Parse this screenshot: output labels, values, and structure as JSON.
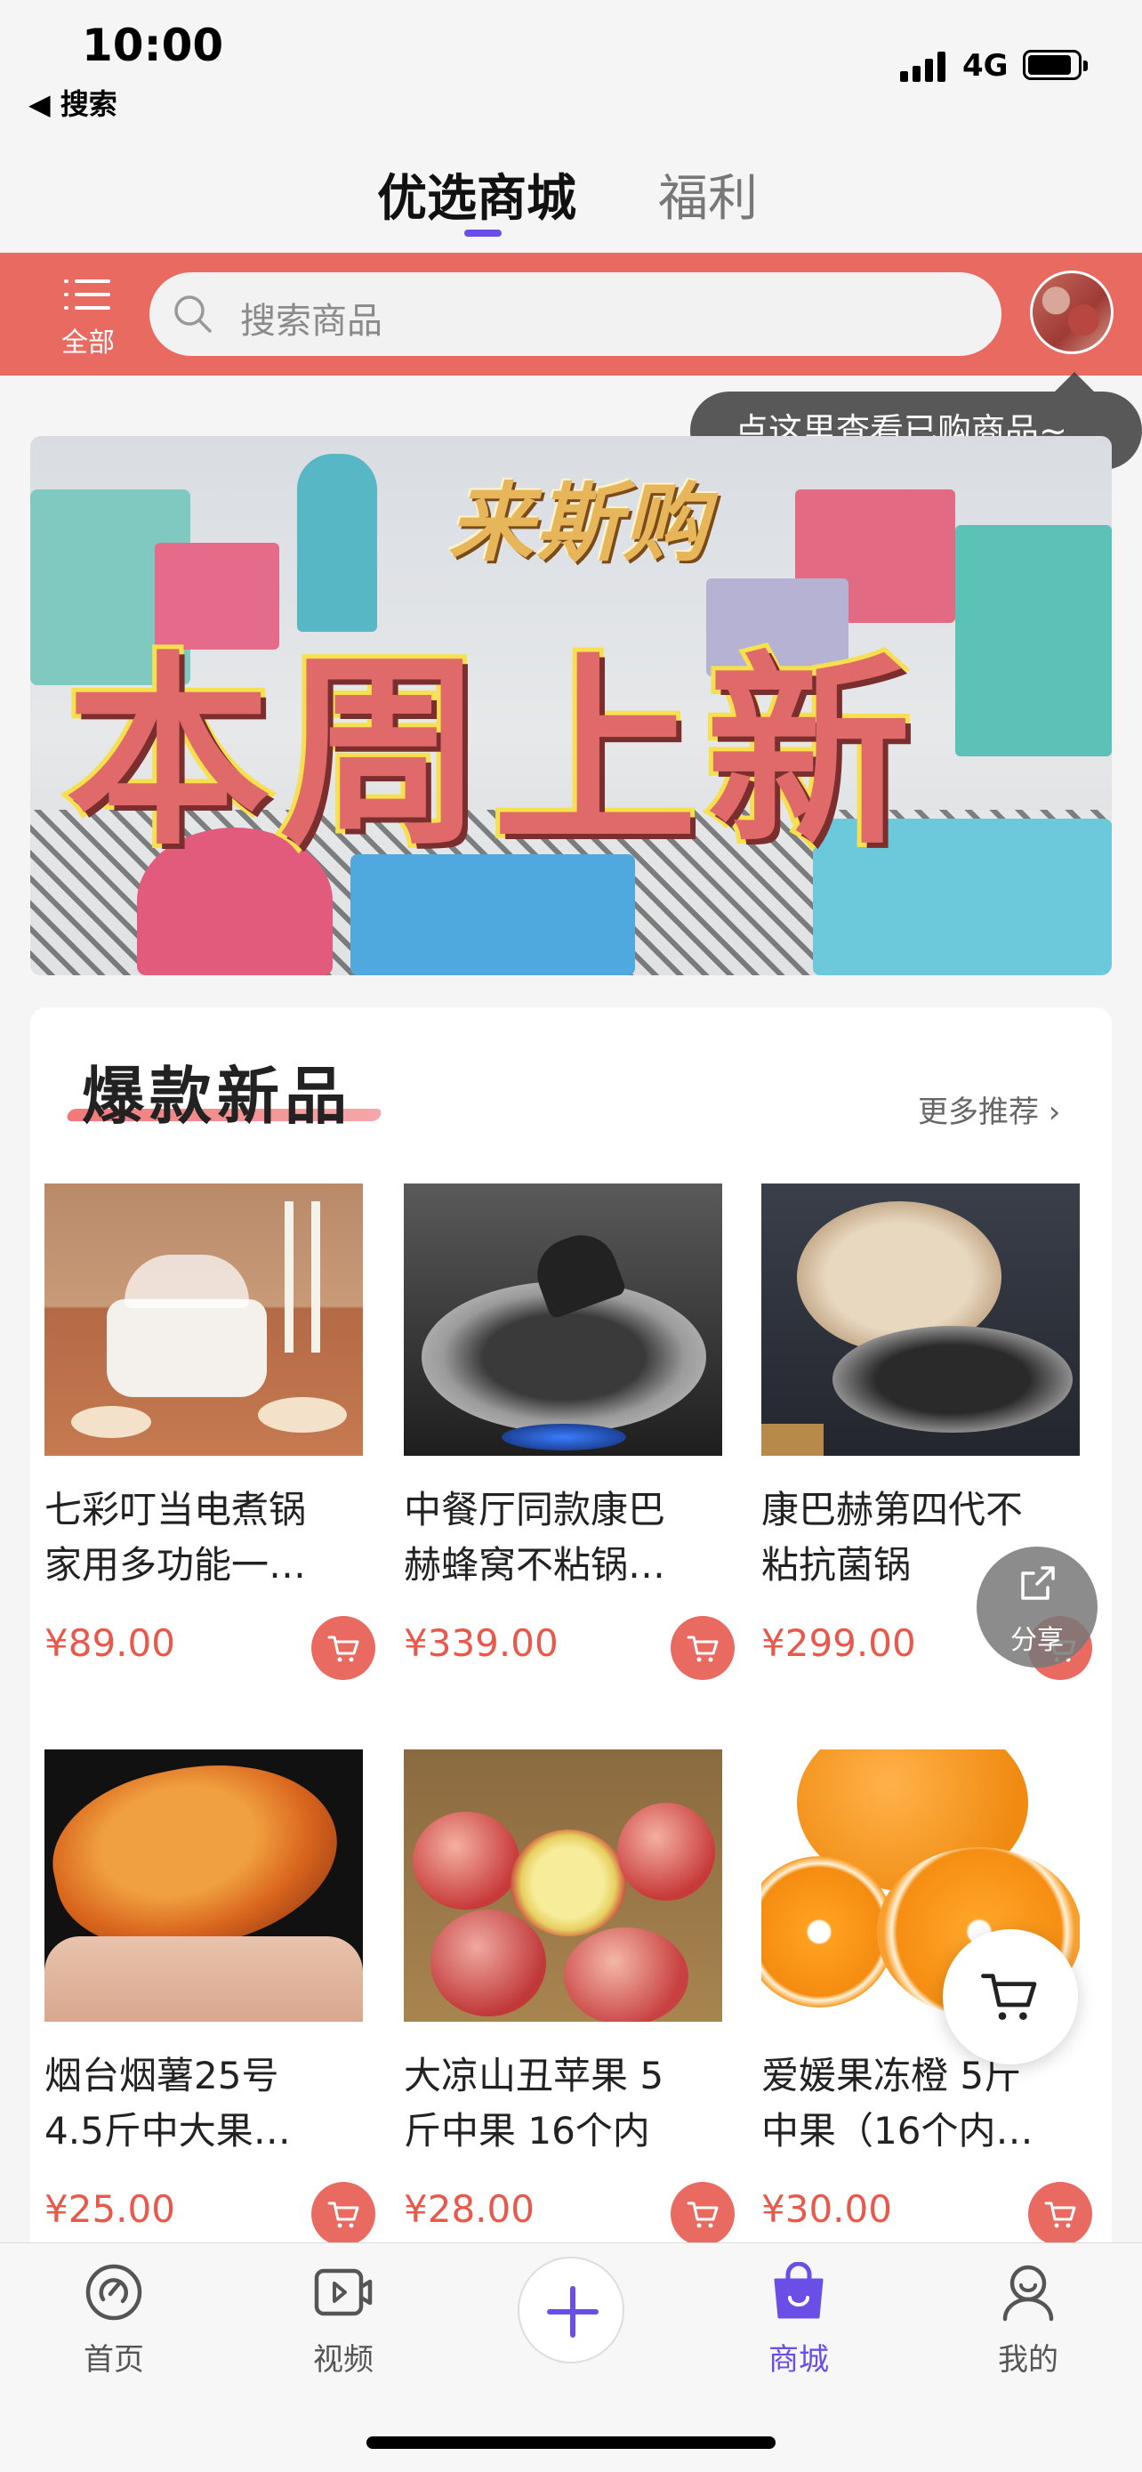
{
  "status_bar": {
    "time": "10:00",
    "back_label": "◀ 搜索",
    "network": "4G"
  },
  "top_tabs": [
    {
      "label": "优选商城",
      "active": true
    },
    {
      "label": "福利",
      "active": false
    }
  ],
  "header": {
    "menu_label": "全部",
    "search_placeholder": "搜索商品",
    "tooltip": "点这里查看已购商品~"
  },
  "banner": {
    "logo_text": "来斯购",
    "title": "本周上新"
  },
  "section": {
    "title": "爆款新品",
    "more_label": "更多推荐 ›"
  },
  "products": [
    {
      "name_line1": "七彩叮当电煮锅",
      "name_line2": "家用多功能一…",
      "price": "¥89.00",
      "image": "electric-pot-photo"
    },
    {
      "name_line1": "中餐厅同款康巴",
      "name_line2": "赫蜂窝不粘锅…",
      "price": "¥339.00",
      "image": "honeycomb-wok-photo"
    },
    {
      "name_line1": "康巴赫第四代不",
      "name_line2": "粘抗菌锅",
      "price": "¥299.00",
      "image": "antibacterial-wok-photo"
    },
    {
      "name_line1": "烟台烟薯25号",
      "name_line2": "4.5斤中大果…",
      "price": "¥25.00",
      "image": "sweet-potato-photo"
    },
    {
      "name_line1": "大凉山丑苹果 5",
      "name_line2": "斤中果 16个内",
      "price": "¥28.00",
      "image": "apple-basket-photo"
    },
    {
      "name_line1": "爱媛果冻橙 5斤",
      "name_line2": "中果（16个内…",
      "price": "¥30.00",
      "image": "orange-photo"
    }
  ],
  "floating": {
    "share_label": "分享"
  },
  "bottom_nav": [
    {
      "label": "首页",
      "icon": "home-icon",
      "active": false
    },
    {
      "label": "视频",
      "icon": "video-icon",
      "active": false
    },
    {
      "label": "",
      "icon": "plus-icon",
      "active": false
    },
    {
      "label": "商城",
      "icon": "shopping-bag-icon",
      "active": true
    },
    {
      "label": "我的",
      "icon": "profile-icon",
      "active": false
    }
  ],
  "colors": {
    "accent": "#6b4ee6",
    "brand_red": "#e96a61",
    "price_red": "#e8584b"
  }
}
